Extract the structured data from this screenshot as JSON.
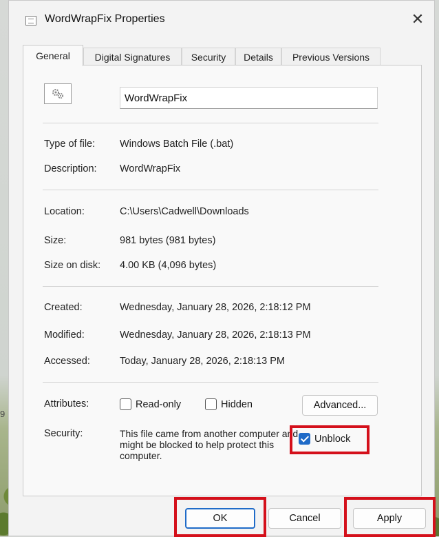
{
  "background": {
    "stray_text": "9"
  },
  "window": {
    "title": "WordWrapFix Properties",
    "close_symbol": "✕",
    "icon": "batch-file-icon"
  },
  "tabs": [
    {
      "label": "General",
      "active": true
    },
    {
      "label": "Digital Signatures"
    },
    {
      "label": "Security"
    },
    {
      "label": "Details"
    },
    {
      "label": "Previous Versions"
    }
  ],
  "general": {
    "file_icon": "gear-file-icon",
    "file_name": "WordWrapFix",
    "type_label": "Type of file:",
    "type_value": "Windows Batch File (.bat)",
    "description_label": "Description:",
    "description_value": "WordWrapFix",
    "location_label": "Location:",
    "location_value": "C:\\Users\\Cadwell\\Downloads",
    "size_label": "Size:",
    "size_value": "981 bytes (981 bytes)",
    "size_on_disk_label": "Size on disk:",
    "size_on_disk_value": "4.00 KB (4,096 bytes)",
    "created_label": "Created:",
    "created_value": "Wednesday, January 28, 2026, 2:18:12 PM",
    "modified_label": "Modified:",
    "modified_value": "Wednesday, January 28, 2026, 2:18:13 PM",
    "accessed_label": "Accessed:",
    "accessed_value": "Today, January 28, 2026, 2:18:13 PM",
    "attributes_label": "Attributes:",
    "readonly_label": "Read-only",
    "readonly_checked": false,
    "hidden_label": "Hidden",
    "hidden_checked": false,
    "advanced_label": "Advanced...",
    "security_label": "Security:",
    "security_text": "This file came from another computer and might be blocked to help protect this computer.",
    "unblock_label": "Unblock",
    "unblock_checked": true
  },
  "buttons": {
    "ok_label": "OK",
    "cancel_label": "Cancel",
    "apply_label": "Apply"
  },
  "colors": {
    "highlight": "#d4101b",
    "accent": "#1f6bc8"
  }
}
